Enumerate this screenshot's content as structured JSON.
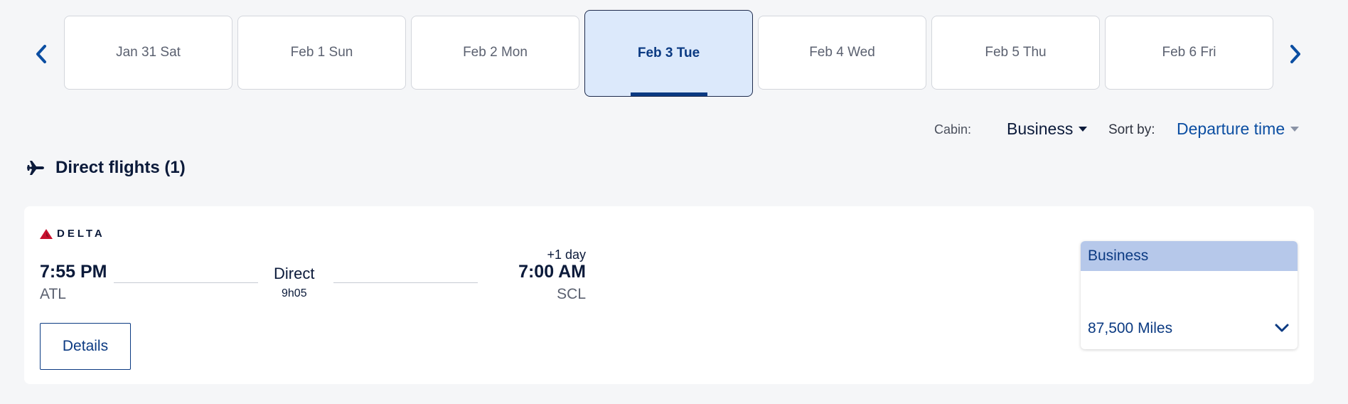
{
  "date_strip": {
    "dates": [
      {
        "label": "Jan 31 Sat"
      },
      {
        "label": "Feb 1 Sun"
      },
      {
        "label": "Feb 2 Mon"
      },
      {
        "label": "Feb 3 Tue",
        "selected": true
      },
      {
        "label": "Feb 4 Wed"
      },
      {
        "label": "Feb 5 Thu"
      },
      {
        "label": "Feb 6 Fri"
      }
    ],
    "prev_icon": "chevron-left-icon",
    "next_icon": "chevron-right-icon"
  },
  "filters": {
    "cabin_label": "Cabin:",
    "cabin_value": "Business",
    "sort_label": "Sort by:",
    "sort_value": "Departure time"
  },
  "section": {
    "icon": "airplane-icon",
    "title": "Direct flights (1)"
  },
  "flight": {
    "airline": "DELTA",
    "departure_time": "7:55 PM",
    "departure_airport": "ATL",
    "stops": "Direct",
    "duration": "9h05",
    "day_offset": "+1 day",
    "arrival_time": "7:00 AM",
    "arrival_airport": "SCL",
    "details_label": "Details",
    "fare": {
      "cabin": "Business",
      "price": "87,500 Miles",
      "expand_icon": "chevron-down-icon"
    }
  },
  "colors": {
    "accent": "#0b3a82",
    "selected_tab_bg": "#dce9fb",
    "fare_header_bg": "#b6c8ea",
    "delta_red": "#c8102e"
  }
}
